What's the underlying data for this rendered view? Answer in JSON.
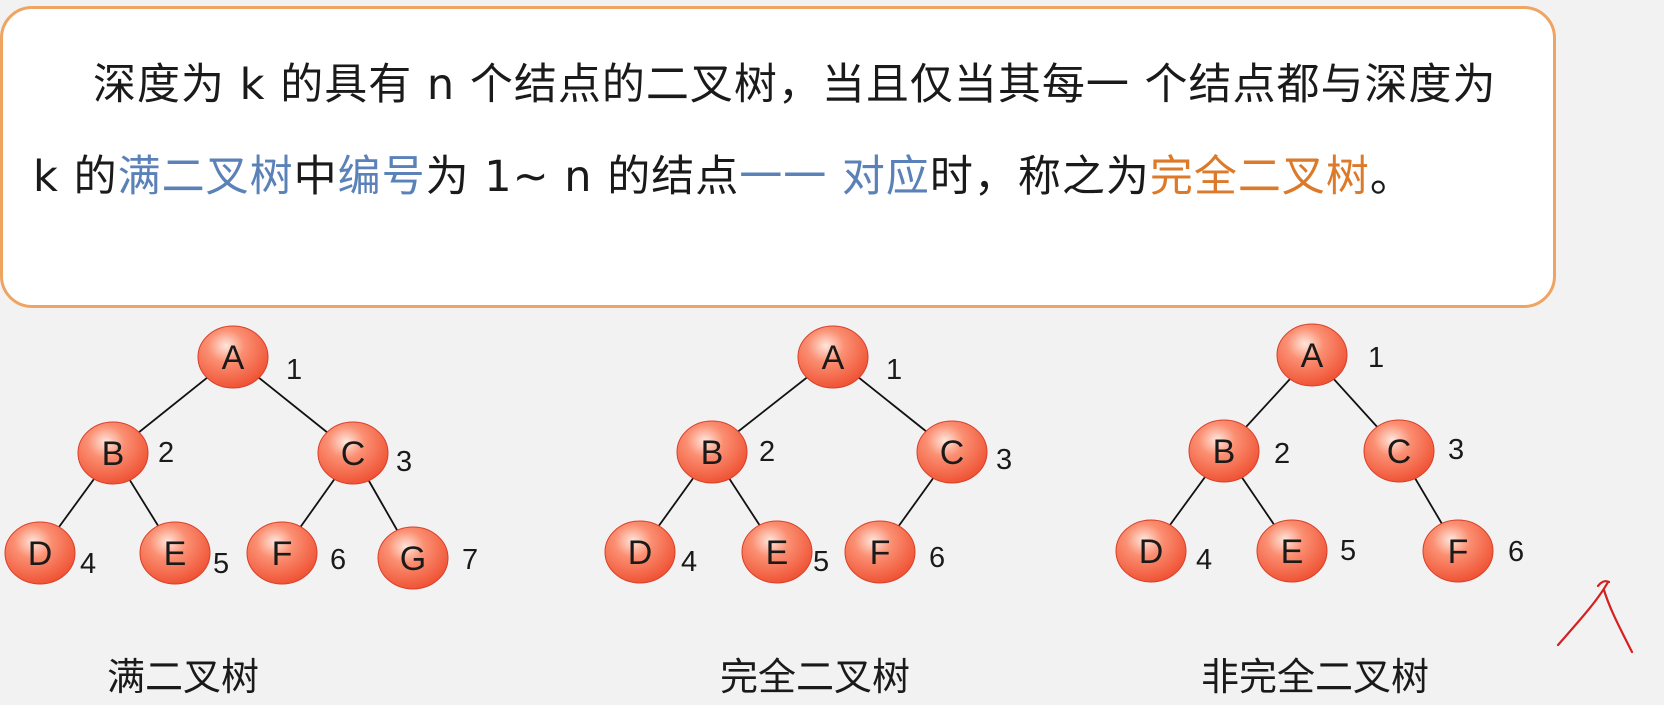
{
  "definition": {
    "t1": "深度为 k 的具有 n 个结点的二叉树，当且仅当其每一 个结点都与深度为 k 的",
    "k1": "满二叉树",
    "t2": "中",
    "k2": "编号",
    "t3": "为 1~ n 的结点",
    "k3": "一一 对应",
    "t4": "时，称之为",
    "k4": "完全二叉树",
    "t5": "。"
  },
  "colors": {
    "keyword_blue": "#5b82b8",
    "keyword_orange": "#dd7a2a",
    "box_border": "#f0a461",
    "node_fill": "#f25a3e",
    "annotation_red": "#d42020"
  },
  "trees": [
    {
      "caption": "满二叉树",
      "nodes": [
        {
          "label": "A",
          "number": "1"
        },
        {
          "label": "B",
          "number": "2"
        },
        {
          "label": "C",
          "number": "3"
        },
        {
          "label": "D",
          "number": "4"
        },
        {
          "label": "E",
          "number": "5"
        },
        {
          "label": "F",
          "number": "6"
        },
        {
          "label": "G",
          "number": "7"
        }
      ]
    },
    {
      "caption": "完全二叉树",
      "nodes": [
        {
          "label": "A",
          "number": "1"
        },
        {
          "label": "B",
          "number": "2"
        },
        {
          "label": "C",
          "number": "3"
        },
        {
          "label": "D",
          "number": "4"
        },
        {
          "label": "E",
          "number": "5"
        },
        {
          "label": "F",
          "number": "6"
        }
      ]
    },
    {
      "caption": "非完全二叉树",
      "nodes": [
        {
          "label": "A",
          "number": "1"
        },
        {
          "label": "B",
          "number": "2"
        },
        {
          "label": "C",
          "number": "3"
        },
        {
          "label": "D",
          "number": "4"
        },
        {
          "label": "E",
          "number": "5"
        },
        {
          "label": "F",
          "number": "6"
        }
      ]
    }
  ]
}
